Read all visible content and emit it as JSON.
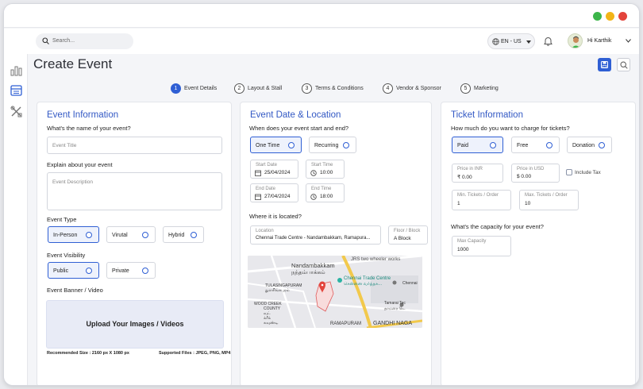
{
  "search": {
    "placeholder": "Search..."
  },
  "header": {
    "language": "EN - US",
    "user_greeting": "Hi Karthik"
  },
  "page": {
    "title": "Create Event"
  },
  "steps": [
    {
      "num": "1",
      "label": "Event Details"
    },
    {
      "num": "2",
      "label": "Layout & Stall"
    },
    {
      "num": "3",
      "label": "Terms & Conditions"
    },
    {
      "num": "4",
      "label": "Vendor & Sponsor"
    },
    {
      "num": "5",
      "label": "Marketing"
    }
  ],
  "event_info": {
    "title": "Event Information",
    "name_question": "What's the name of your event?",
    "name_placeholder": "Event Title",
    "explain_question": "Explain about your event",
    "desc_placeholder": "Event Description",
    "type_label": "Event Type",
    "types": [
      "In-Person",
      "Virutal",
      "Hybrid"
    ],
    "visibility_label": "Event Visibility",
    "visibility": [
      "Public",
      "Private"
    ],
    "banner_label": "Event Banner / Video",
    "upload_text": "Upload Your Images / Videos",
    "recommended": "Recommended Size : 2160 px X 1080 px",
    "supported": "Supported Files : JPEG, PNG, MP4"
  },
  "date_location": {
    "title": "Event Date & Location",
    "when_question": "When does your event start and end?",
    "freq": [
      "One Time",
      "Recurring"
    ],
    "start_date_label": "Start Date",
    "start_date": "25/04/2024",
    "start_time_label": "Start Time",
    "start_time": "10:00",
    "end_date_label": "End Date",
    "end_date": "27/04/2024",
    "end_time_label": "End Time",
    "end_time": "18:00",
    "where_question": "Where it is located?",
    "location_label": "Location",
    "location": "Chennai Trade Centre - Nandambakkam, Ramapura...",
    "floor_label": "Floor / Block",
    "floor": "A Block",
    "map": {
      "place": "Nandambakkam",
      "place_tamil": "நந்தம்பாக்கம்",
      "jrs": "JRS two wheeler works",
      "ctc1": "Chennai Trade Centre",
      "ctc2": "சென்னை வர்த்தக...",
      "tulasi": "TULASINGAPURAM",
      "tulasi_ta": "துளசிங்கபுரம்",
      "woodcreek": "WOOD CREEK",
      "county": "COUNTY",
      "woodcreek_ta": "வுட்",
      "kreek_ta": "க்ரீக்",
      "county_ta": "கவுண்டி",
      "tamarai": "Tamarai Tec",
      "tamarai_ta": "தாமரை டெ",
      "ramapuram": "RAMAPURAM",
      "gandhi": "GANDHI NAGA",
      "chennai": "Chennai"
    }
  },
  "tickets": {
    "title": "Ticket Information",
    "charge_question": "How much do you want to charge for tickets?",
    "options": [
      "Paid",
      "Free",
      "Donation"
    ],
    "inr_label": "Price in INR",
    "inr_value": "₹ 0.00",
    "usd_label": "Price in USD",
    "usd_value": "$ 0.00",
    "include_tax": "Include Tax",
    "min_label": "Min. Tickets / Order",
    "min_value": "1",
    "max_label": "Max. Tickets / Order",
    "max_value": "10",
    "capacity_question": "What's the capacity for your event?",
    "capacity_label": "Max Capacity",
    "capacity_value": "1000"
  },
  "colors": {
    "accent": "#2f5fd4",
    "title_blue": "#3258c4",
    "red": "#e3433b",
    "yellow": "#f2b417",
    "green": "#3cb54a"
  }
}
